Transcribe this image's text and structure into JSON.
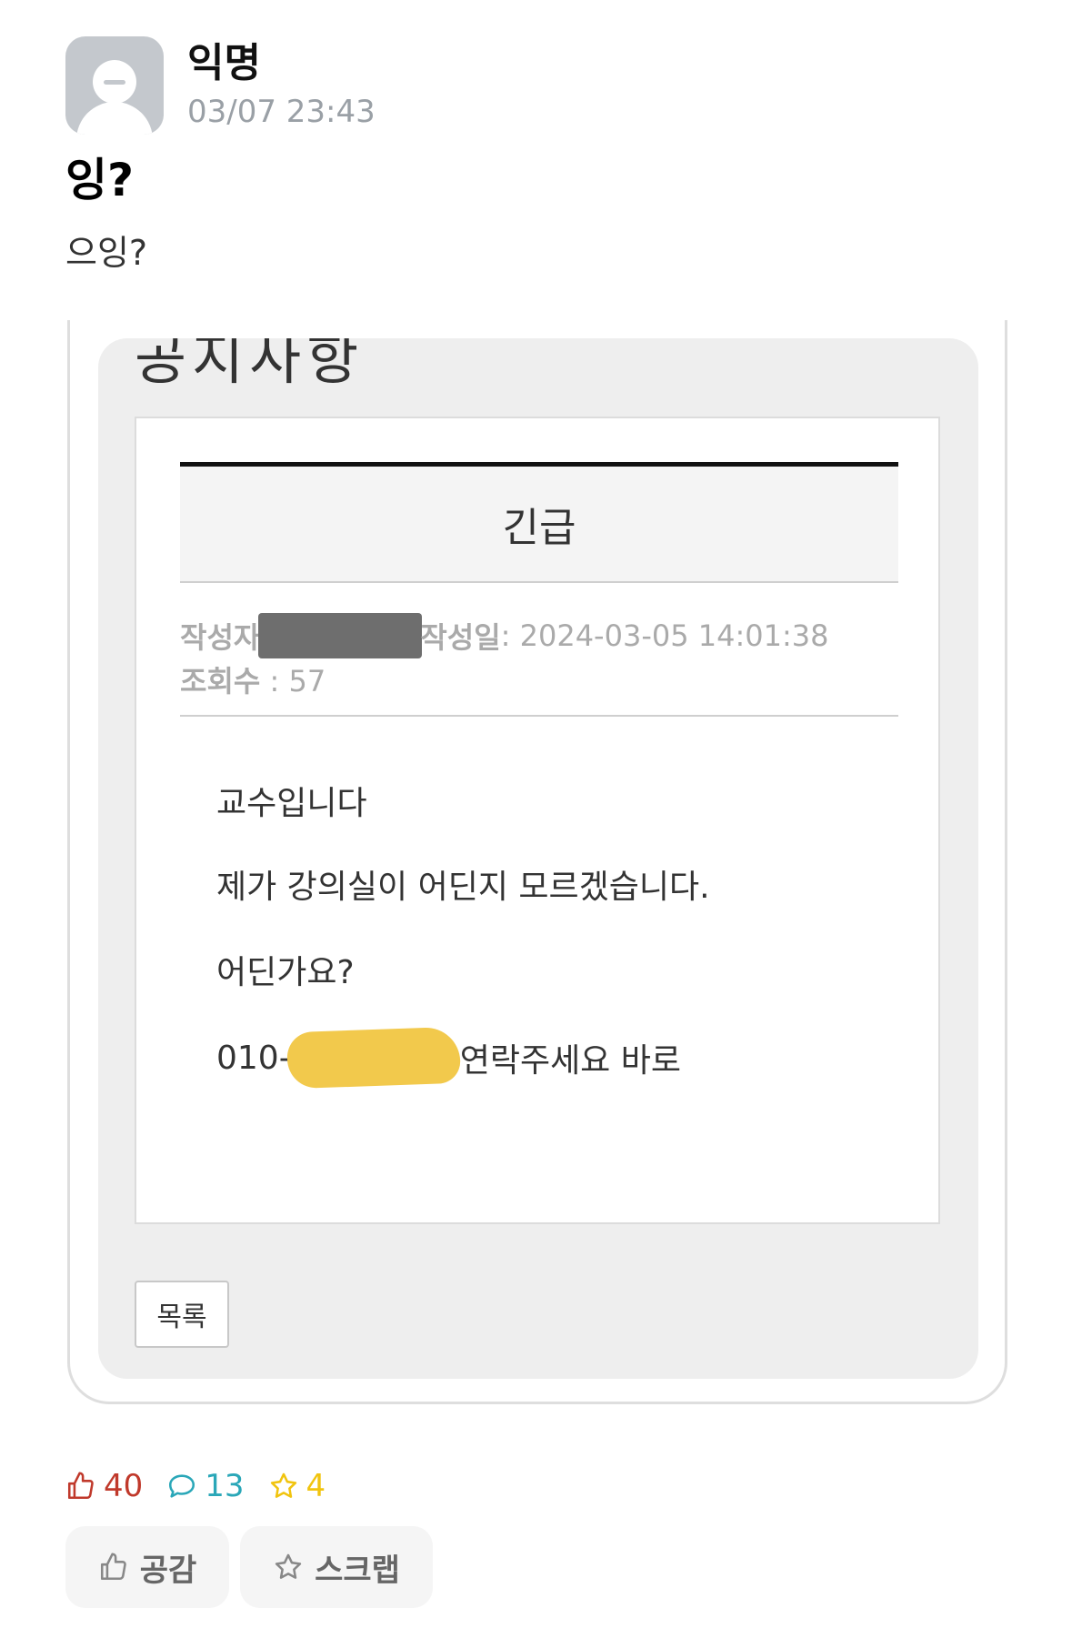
{
  "post": {
    "author": "익명",
    "time": "03/07 23:43",
    "title": "잉?",
    "body": "으잉?"
  },
  "image": {
    "page_title": "공지사항",
    "subject": "긴급",
    "author_label": "작성자",
    "date_label": "작성일",
    "date_value": " : 2024-03-05 14:01:38",
    "views_label": "조회수",
    "views_value": " : 57",
    "lines": {
      "l1": "교수입니다",
      "l2": "제가 강의실이 어딘지 모르겠습니다.",
      "l3": "어딘가요?",
      "l4_prefix": "010-",
      "l4_suffix": "연락주세요 바로"
    },
    "list_button": "목록"
  },
  "stats": {
    "likes": "40",
    "comments": "13",
    "scraps": "4"
  },
  "actions": {
    "like": "공감",
    "scrap": "스크랩"
  },
  "colors": {
    "like": "#c0392b",
    "comment": "#2aa7b8",
    "scrap": "#f1c40f"
  }
}
